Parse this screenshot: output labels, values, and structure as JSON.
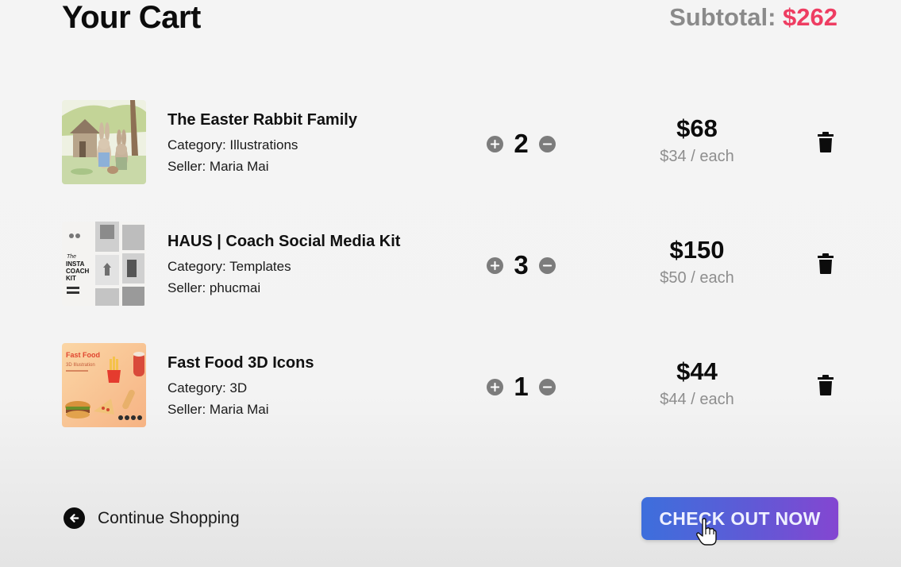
{
  "header": {
    "title": "Your Cart",
    "subtotal_label": "Subtotal:",
    "subtotal_amount": "$262"
  },
  "items": [
    {
      "name": "The Easter Rabbit Family",
      "category": "Category: Illustrations",
      "seller": "Seller: Maria Mai",
      "quantity": "2",
      "price": "$68",
      "each": "$34 / each"
    },
    {
      "name": "HAUS | Coach Social Media Kit",
      "category": "Category: Templates",
      "seller": "Seller: phucmai",
      "quantity": "3",
      "price": "$150",
      "each": "$50 / each"
    },
    {
      "name": "Fast Food 3D Icons",
      "category": "Category: 3D",
      "seller": "Seller: Maria Mai",
      "quantity": "1",
      "price": "$44",
      "each": "$44 / each"
    }
  ],
  "thumbnails": {
    "coach_kit_text": "INSTA COACH KIT",
    "fastfood_title": "Fast Food",
    "fastfood_subtitle": "3D Illustration"
  },
  "footer": {
    "continue_label": "Continue Shopping",
    "checkout_label": "CHECK OUT NOW"
  },
  "colors": {
    "accent": "#ee3d62",
    "checkout_start": "#3d6fdc",
    "checkout_end": "#8446d1"
  },
  "icons": {
    "increase": "plus-circle-icon",
    "decrease": "minus-circle-icon",
    "delete": "trash-icon",
    "back": "arrow-left-circle-icon"
  }
}
